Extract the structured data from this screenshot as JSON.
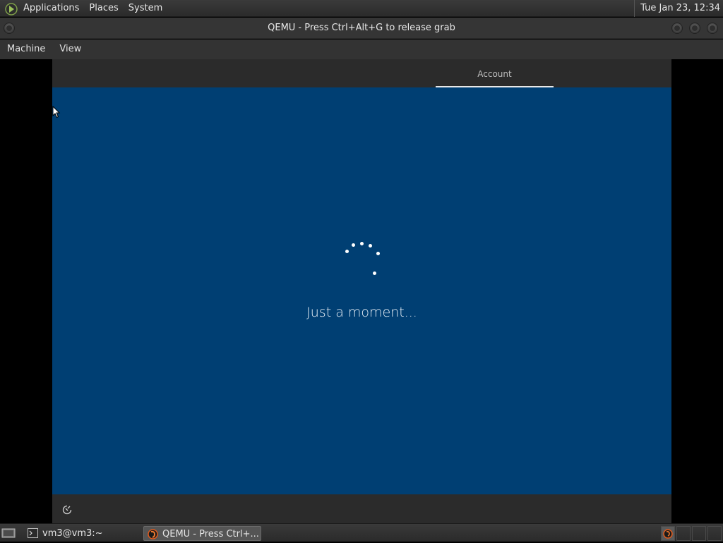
{
  "top_panel": {
    "menu": [
      "Applications",
      "Places",
      "System"
    ],
    "clock": "Tue Jan 23, 12:34"
  },
  "window": {
    "title": "QEMU - Press Ctrl+Alt+G to release grab",
    "menubar": [
      "Machine",
      "View"
    ]
  },
  "guest": {
    "tab_label": "Account",
    "status_text": "Just a moment...",
    "background_color": "#003f73"
  },
  "taskbar": {
    "tasks": [
      {
        "label": "vm3@vm3:~",
        "icon": "terminal-icon"
      },
      {
        "label": "QEMU - Press Ctrl+...",
        "icon": "qemu-icon"
      }
    ]
  }
}
